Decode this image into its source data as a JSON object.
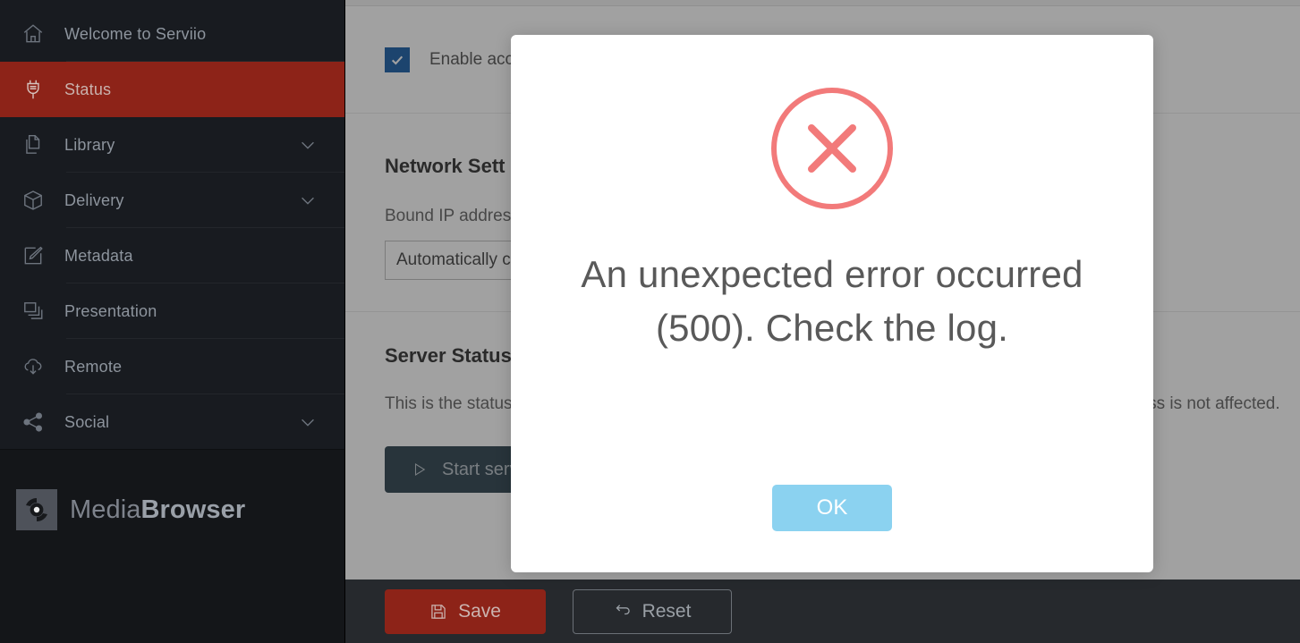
{
  "sidebar": {
    "items": [
      {
        "label": "Welcome to Serviio",
        "icon": "home-icon",
        "expandable": false,
        "active": false
      },
      {
        "label": "Status",
        "icon": "plug-icon",
        "expandable": false,
        "active": true
      },
      {
        "label": "Library",
        "icon": "files-icon",
        "expandable": true,
        "active": false
      },
      {
        "label": "Delivery",
        "icon": "box-icon",
        "expandable": true,
        "active": false
      },
      {
        "label": "Metadata",
        "icon": "pencil-square-icon",
        "expandable": false,
        "active": false
      },
      {
        "label": "Presentation",
        "icon": "layers-icon",
        "expandable": false,
        "active": false
      },
      {
        "label": "Remote",
        "icon": "cloud-download-icon",
        "expandable": false,
        "active": false
      },
      {
        "label": "Social",
        "icon": "share-icon",
        "expandable": true,
        "active": false
      }
    ],
    "brand": {
      "name_light": "Media",
      "name_bold": "Browser",
      "mark": "mediabrowser-logo-icon"
    },
    "active_color": "#8d2318",
    "background_color": "#181b20"
  },
  "main": {
    "access_checkbox": {
      "label": "Enable acc",
      "checked": true,
      "checked_color": "#1a5fa8"
    },
    "network_section": {
      "title": "Network Sett",
      "field_label": "Bound IP addres",
      "select_value": "Automatically c"
    },
    "server_section": {
      "title": "Server Status",
      "description_left": "This is the status",
      "description_right": "ss is not affected.",
      "start_button": {
        "label": "Start serv",
        "icon": "play-icon"
      }
    },
    "footer": {
      "save_button": {
        "label": "Save",
        "icon": "floppy-disk-icon",
        "color": "#8d2318"
      },
      "reset_button": {
        "label": "Reset",
        "icon": "reset-arrow-icon"
      }
    }
  },
  "modal": {
    "icon": "error-circle-x-icon",
    "icon_color": "#f27a7a",
    "message": "An unexpected error occurred (500). Check the log.",
    "ok_button": {
      "label": "OK",
      "color": "#8bd2f0"
    }
  }
}
